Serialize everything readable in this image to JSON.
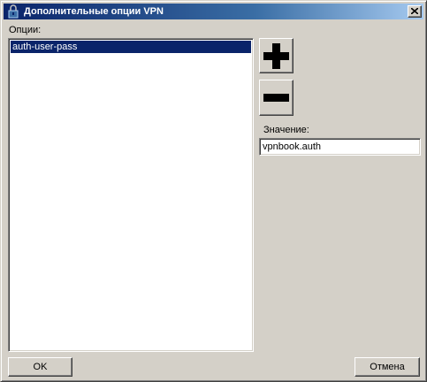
{
  "window": {
    "title": "Дополнительные опции VPN",
    "close_label": "×"
  },
  "options": {
    "label": "Опции:",
    "items": [
      {
        "label": "auth-user-pass",
        "selected": true
      }
    ]
  },
  "value": {
    "label": "Значение:",
    "text": "vpnbook.auth"
  },
  "buttons": {
    "add_icon": "plus-icon",
    "remove_icon": "minus-icon",
    "ok_label": "OK",
    "cancel_label": "Отмена"
  },
  "colors": {
    "titlebar": "#0a246a",
    "selection": "#0a246a",
    "face": "#d4d0c8"
  }
}
